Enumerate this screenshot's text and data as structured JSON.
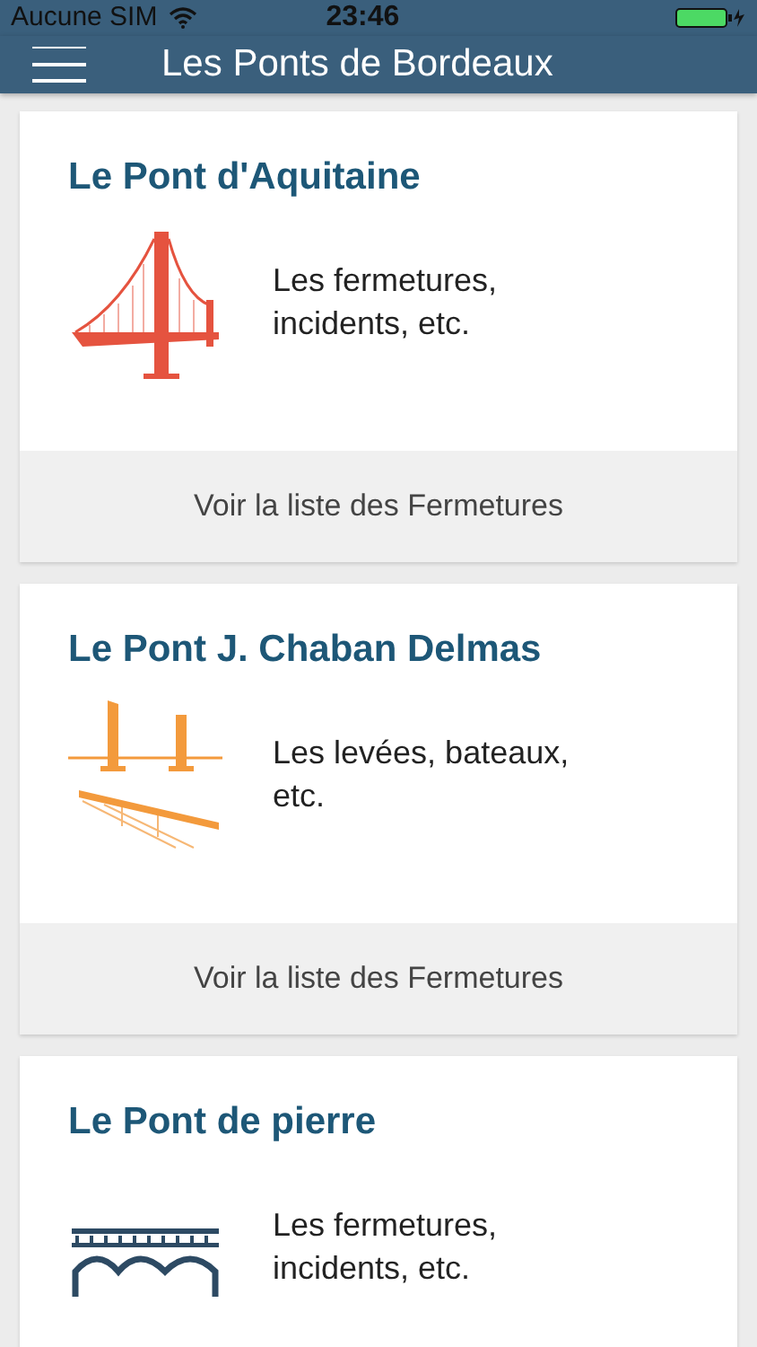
{
  "status_bar": {
    "carrier": "Aucune SIM",
    "time": "23:46"
  },
  "nav_bar": {
    "title": "Les Ponts de Bordeaux"
  },
  "bridges": [
    {
      "name": "Le Pont d'Aquitaine",
      "kind": "suspension",
      "description": "Les fermetures, incidents, etc.",
      "link": "Voir la liste des Fermetures"
    },
    {
      "name": "Le Pont J. Chaban Delmas",
      "kind": "lift",
      "description": "Les levées, bateaux, etc.",
      "link": "Voir la liste des Fermetures"
    },
    {
      "name": "Le Pont de pierre",
      "kind": "arch",
      "description": "Les fermetures, incidents, etc."
    }
  ]
}
